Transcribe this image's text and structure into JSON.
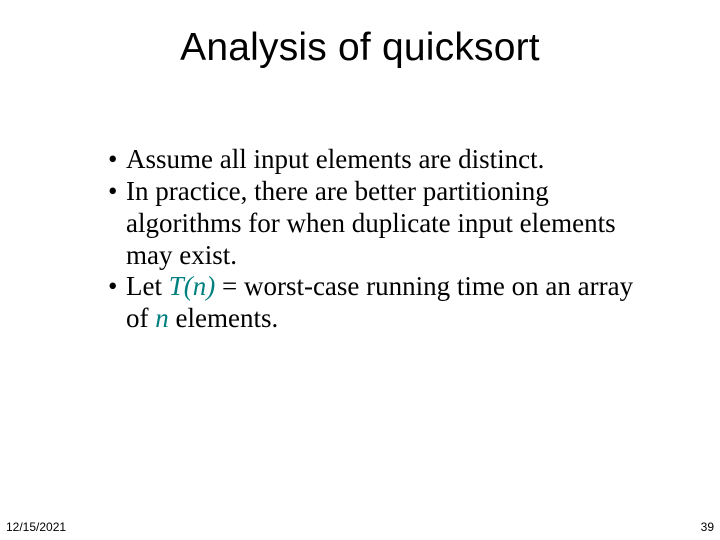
{
  "title": "Analysis of quicksort",
  "bullets": [
    {
      "mark": "•",
      "text": "Assume all input elements are distinct."
    },
    {
      "mark": "•",
      "text": "In practice, there are better partitioning algorithms for when duplicate input elements may exist."
    },
    {
      "mark": "•",
      "pre": "Let ",
      "var1": "T(n)",
      "mid": " = worst-case running time on an array of ",
      "var2": "n",
      "post": " elements."
    }
  ],
  "footer": {
    "date": "12/15/2021",
    "page": "39"
  }
}
